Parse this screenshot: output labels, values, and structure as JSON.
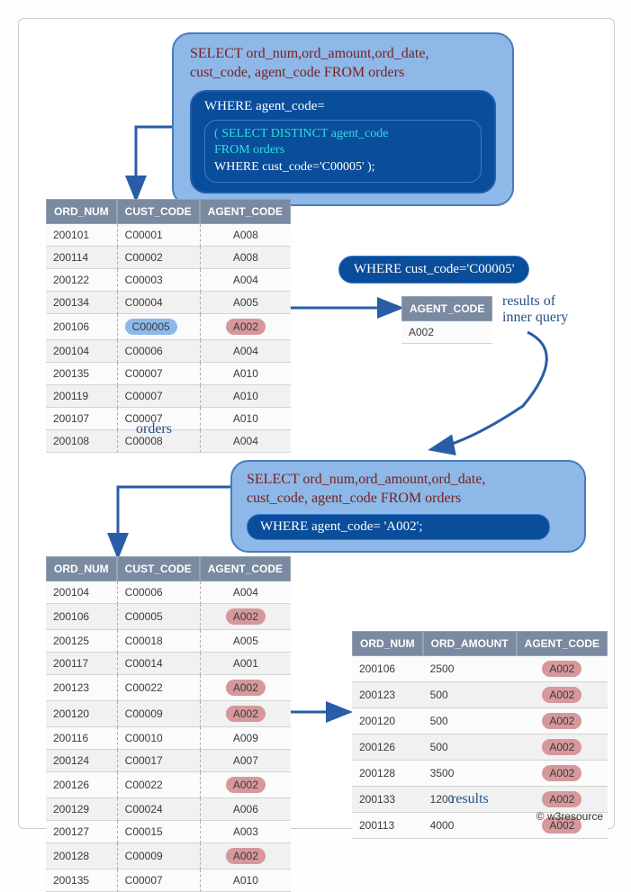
{
  "query_main": {
    "select": "SELECT ord_num,ord_amount,ord_date,\ncust_code, agent_code FROM orders",
    "where": "WHERE agent_code=",
    "sub_line1": "( SELECT DISTINCT agent_code",
    "sub_line2": "FROM orders",
    "sub_line3": "WHERE cust_code='C00005' );"
  },
  "where_cust_pill": "WHERE cust_code='C00005'",
  "inner_result_label": "results of\ninner query",
  "agent_small": {
    "header": "AGENT_CODE",
    "rows": [
      "A002"
    ]
  },
  "query_2": {
    "select": "SELECT ord_num,ord_amount,ord_date,\ncust_code, agent_code FROM orders",
    "where": "WHERE agent_code= 'A002';"
  },
  "orders_table": {
    "label": "orders",
    "headers": [
      "ORD_NUM",
      "CUST_CODE",
      "AGENT_CODE"
    ],
    "rows": [
      {
        "ord_num": "200101",
        "cust_code": "C00001",
        "agent_code": "A008"
      },
      {
        "ord_num": "200114",
        "cust_code": "C00002",
        "agent_code": "A008"
      },
      {
        "ord_num": "200122",
        "cust_code": "C00003",
        "agent_code": "A004"
      },
      {
        "ord_num": "200134",
        "cust_code": "C00004",
        "agent_code": "A005"
      },
      {
        "ord_num": "200106",
        "cust_code": "C00005",
        "agent_code": "A002",
        "hl_cust": true,
        "hl_agent": true
      },
      {
        "ord_num": "200104",
        "cust_code": "C00006",
        "agent_code": "A004"
      },
      {
        "ord_num": "200135",
        "cust_code": "C00007",
        "agent_code": "A010"
      },
      {
        "ord_num": "200119",
        "cust_code": "C00007",
        "agent_code": "A010"
      },
      {
        "ord_num": "200107",
        "cust_code": "C00007",
        "agent_code": "A010"
      },
      {
        "ord_num": "200108",
        "cust_code": "C00008",
        "agent_code": "A004"
      }
    ]
  },
  "orders_table_2": {
    "headers": [
      "ORD_NUM",
      "CUST_CODE",
      "AGENT_CODE"
    ],
    "rows": [
      {
        "ord_num": "200104",
        "cust_code": "C00006",
        "agent_code": "A004"
      },
      {
        "ord_num": "200106",
        "cust_code": "C00005",
        "agent_code": "A002",
        "hl_agent": true
      },
      {
        "ord_num": "200125",
        "cust_code": "C00018",
        "agent_code": "A005"
      },
      {
        "ord_num": "200117",
        "cust_code": "C00014",
        "agent_code": "A001"
      },
      {
        "ord_num": "200123",
        "cust_code": "C00022",
        "agent_code": "A002",
        "hl_agent": true
      },
      {
        "ord_num": "200120",
        "cust_code": "C00009",
        "agent_code": "A002",
        "hl_agent": true
      },
      {
        "ord_num": "200116",
        "cust_code": "C00010",
        "agent_code": "A009"
      },
      {
        "ord_num": "200124",
        "cust_code": "C00017",
        "agent_code": "A007"
      },
      {
        "ord_num": "200126",
        "cust_code": "C00022",
        "agent_code": "A002",
        "hl_agent": true
      },
      {
        "ord_num": "200129",
        "cust_code": "C00024",
        "agent_code": "A006"
      },
      {
        "ord_num": "200127",
        "cust_code": "C00015",
        "agent_code": "A003"
      },
      {
        "ord_num": "200128",
        "cust_code": "C00009",
        "agent_code": "A002",
        "hl_agent": true
      },
      {
        "ord_num": "200135",
        "cust_code": "C00007",
        "agent_code": "A010"
      }
    ]
  },
  "results_table": {
    "label": "results",
    "headers": [
      "ORD_NUM",
      "ORD_AMOUNT",
      "AGENT_CODE"
    ],
    "rows": [
      {
        "ord_num": "200106",
        "ord_amount": "2500",
        "agent_code": "A002"
      },
      {
        "ord_num": "200123",
        "ord_amount": "500",
        "agent_code": "A002"
      },
      {
        "ord_num": "200120",
        "ord_amount": "500",
        "agent_code": "A002"
      },
      {
        "ord_num": "200126",
        "ord_amount": "500",
        "agent_code": "A002"
      },
      {
        "ord_num": "200128",
        "ord_amount": "3500",
        "agent_code": "A002"
      },
      {
        "ord_num": "200133",
        "ord_amount": "1200",
        "agent_code": "A002"
      },
      {
        "ord_num": "200113",
        "ord_amount": "4000",
        "agent_code": "A002"
      }
    ]
  },
  "footer": "© w3resource"
}
